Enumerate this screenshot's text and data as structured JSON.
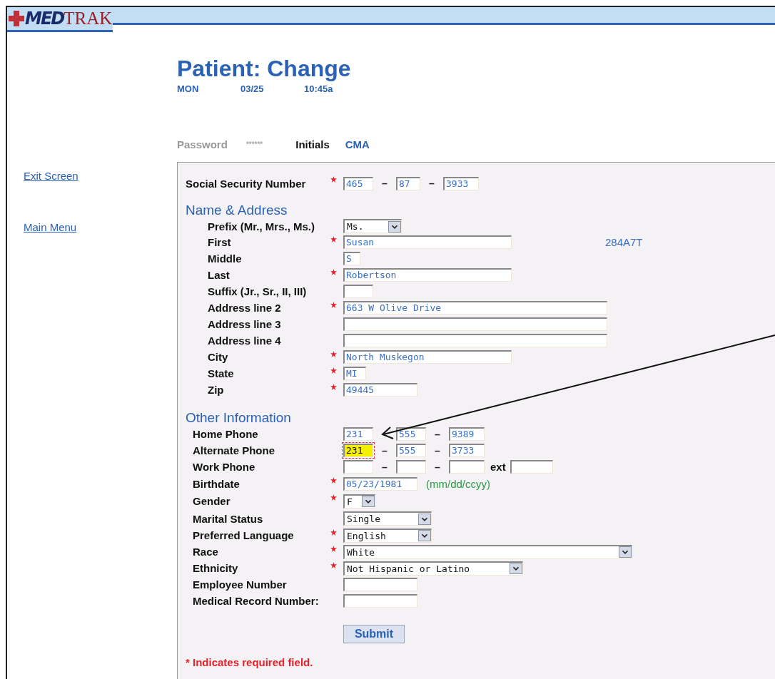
{
  "logo": {
    "first": "MED",
    "second": "TRAK"
  },
  "title": "Patient: Change",
  "stamp": {
    "day": "MON",
    "date": "03/25",
    "time": "10:45a"
  },
  "login": {
    "password_label": "Password",
    "password_value": "******",
    "initials_label": "Initials",
    "initials_value": "CMA"
  },
  "nav": [
    "Exit Screen",
    "Main Menu"
  ],
  "ssn": {
    "label": "Social Security Number",
    "required": true,
    "parts": [
      {
        "value": "465"
      },
      {
        "value": "87",
        "sep": "–"
      },
      {
        "value": "3933",
        "sep": "–"
      }
    ]
  },
  "sections": [
    {
      "title": "Name & Address",
      "rows": [
        {
          "label": "Prefix (Mr., Mrs., Ms.)",
          "required": false,
          "kind": "select",
          "value": "Ms."
        },
        {
          "label": "First",
          "required": true,
          "kind": "text",
          "value": "Susan",
          "note": "284A7T"
        },
        {
          "label": "Middle",
          "required": false,
          "kind": "text",
          "value": "S"
        },
        {
          "label": "Last",
          "required": true,
          "kind": "text",
          "value": "Robertson"
        },
        {
          "label": "Suffix (Jr., Sr., II, III)",
          "required": false,
          "kind": "text"
        },
        {
          "label": "Address line 2",
          "required": true,
          "kind": "text",
          "value": "663 W Olive Drive"
        },
        {
          "label": "Address line 3",
          "required": false,
          "kind": "text"
        },
        {
          "label": "Address line 4",
          "required": false,
          "kind": "text"
        },
        {
          "label": "City",
          "required": true,
          "kind": "text",
          "value": "North Muskegon"
        },
        {
          "label": "State",
          "required": true,
          "kind": "text",
          "value": "MI"
        },
        {
          "label": "Zip",
          "required": true,
          "kind": "text",
          "value": "49445"
        }
      ]
    },
    {
      "title": "Other Information",
      "rows": [
        {
          "label": "Home Phone",
          "required": false,
          "kind": "phone",
          "parts": [
            {
              "value": "231",
              "focused": false
            },
            {
              "value": "555",
              "focused": false
            },
            {
              "value": "9389",
              "focused": false,
              "sep": "–"
            }
          ]
        },
        {
          "label": "Alternate Phone",
          "required": false,
          "kind": "phone",
          "parts": [
            {
              "value": "231",
              "focused": true
            },
            {
              "value": "555",
              "focused": false,
              "sep": "–"
            },
            {
              "value": "3733",
              "focused": false,
              "sep": "–"
            }
          ]
        },
        {
          "label": "Work Phone",
          "required": false,
          "kind": "phone",
          "parts": [
            {
              "focused": false
            },
            {
              "focused": false,
              "sep": "–"
            },
            {
              "focused": false,
              "sep": "–"
            }
          ],
          "ext_label": "ext"
        },
        {
          "label": "Birthdate",
          "required": true,
          "kind": "date",
          "value": "05/23/1981",
          "hint": "(mm/dd/ccyy)"
        },
        {
          "label": "Gender",
          "required": true,
          "kind": "select",
          "value": "F"
        },
        {
          "label": "Marital Status",
          "required": false,
          "kind": "select",
          "value": "Single"
        },
        {
          "label": "Preferred Language",
          "required": true,
          "kind": "select",
          "value": "English"
        },
        {
          "label": "Race",
          "required": true,
          "kind": "select",
          "value": "White"
        },
        {
          "label": "Ethnicity",
          "required": true,
          "kind": "select",
          "value": "Not Hispanic or Latino"
        },
        {
          "label": "Employee Number",
          "required": false,
          "kind": "text"
        },
        {
          "label": "Medical Record Number:",
          "required": false,
          "kind": "text"
        }
      ]
    }
  ],
  "submit": "Submit",
  "footnote": "* Indicates required field."
}
